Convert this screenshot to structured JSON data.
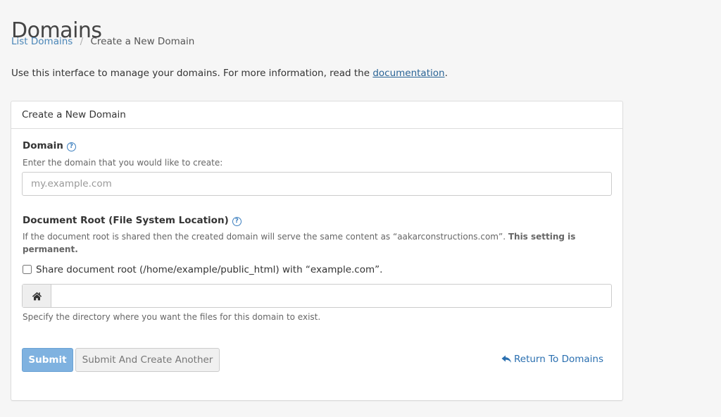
{
  "header": {
    "title": "Domains"
  },
  "breadcrumb": {
    "parent": "List Domains",
    "separator": "/",
    "current": "Create a New Domain"
  },
  "intro": {
    "text_before": "Use this interface to manage your domains. For more information, read the ",
    "link_text": "documentation",
    "text_after": "."
  },
  "panel": {
    "heading": "Create a New Domain",
    "domain_field": {
      "label": "Domain",
      "hint": "Enter the domain that you would like to create:",
      "placeholder": "my.example.com",
      "value": ""
    },
    "docroot_field": {
      "label": "Document Root (File System Location)",
      "hint_text": "If the document root is shared then the created domain will serve the same content as “aakarconstructions.com”. ",
      "hint_bold": "This setting is permanent.",
      "share_checkbox_label": "Share document root (/home/example/public_html) with “example.com”.",
      "share_checked": false,
      "value": "",
      "help_text": "Specify the directory where you want the files for this domain to exist."
    },
    "actions": {
      "submit_label": "Submit",
      "submit_another_label": "Submit And Create Another",
      "return_label": "Return To Domains"
    }
  },
  "icons": {
    "help": "question-circle-icon",
    "home": "home-icon",
    "return": "reply-arrow-icon"
  },
  "colors": {
    "link": "#2a6fb0",
    "primary_button": "#7fb2e0",
    "help_icon": "#3c7fbf"
  }
}
